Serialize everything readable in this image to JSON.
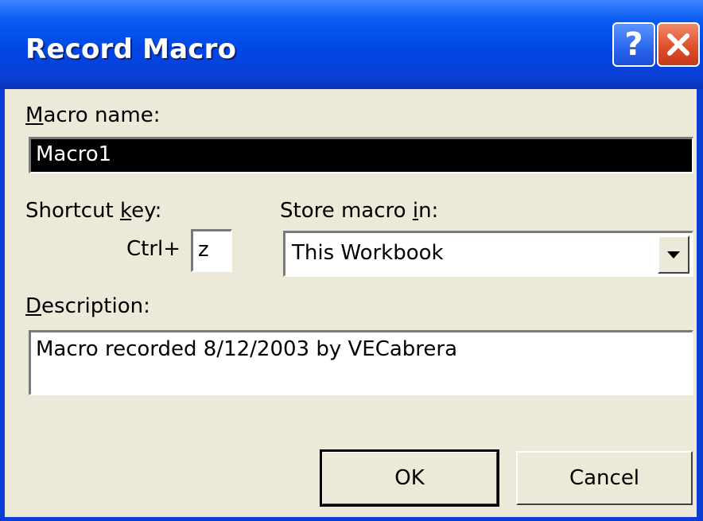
{
  "window": {
    "title": "Record Macro",
    "help_glyph": "?",
    "colors": {
      "titlebar": "#0a3fd6",
      "client": "#ece9d8",
      "close": "#e0502c"
    }
  },
  "form": {
    "macro_name": {
      "label_hot": "M",
      "label_rest": "acro name:",
      "value": "Macro1"
    },
    "shortcut": {
      "label_pre": "Shortcut ",
      "label_hot": "k",
      "label_rest": "ey:",
      "prefix": "Ctrl+",
      "value": "z"
    },
    "store": {
      "label_pre": "Store macro ",
      "label_hot": "i",
      "label_rest": "n:",
      "selected": "This Workbook",
      "icon": "chevron-down-icon"
    },
    "description": {
      "label_hot": "D",
      "label_rest": "escription:",
      "value": "Macro recorded 8/12/2003 by VECabrera"
    }
  },
  "buttons": {
    "ok": "OK",
    "cancel": "Cancel"
  }
}
